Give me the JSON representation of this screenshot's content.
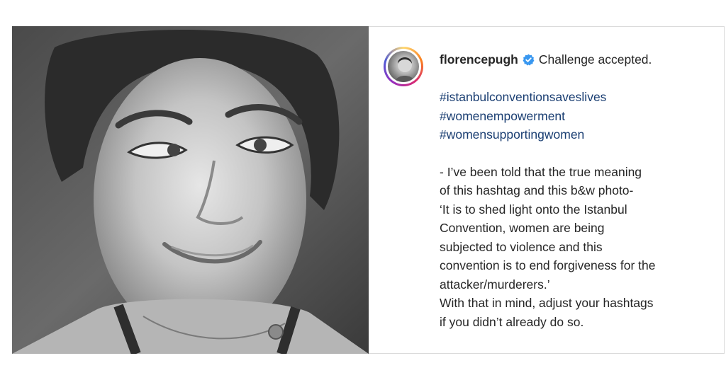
{
  "post": {
    "username": "florencepugh",
    "verified": true,
    "headline": "Challenge accepted.",
    "hashtags": [
      "#istanbulconventionsaveslives",
      "#womenempowerment",
      "#womensupportingwomen"
    ],
    "body_lines": [
      "- I’ve been told that the true meaning",
      "of this hashtag and this b&w photo-",
      "‘It is to shed light onto the Istanbul",
      "Convention, women are being",
      "subjected to violence and this",
      "convention is to end forgiveness for the",
      "attacker/murderers.’",
      "With that in mind, adjust your hashtags",
      "if you didn’t already do so."
    ]
  },
  "icons": {
    "verified": "verified-badge-icon",
    "avatar": "profile-avatar"
  },
  "colors": {
    "hashtag": "#1a3e72",
    "text": "#262626",
    "verified": "#3897f0",
    "border": "#dbdbdb"
  }
}
